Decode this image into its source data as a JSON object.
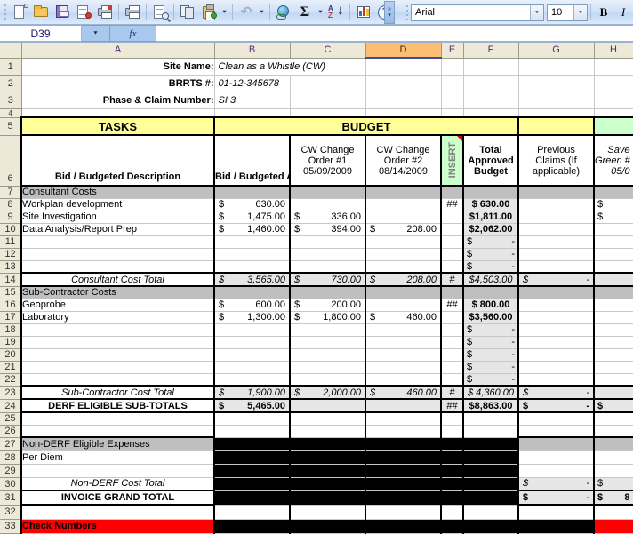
{
  "toolbar": {
    "icons": [
      "new-document",
      "open-folder",
      "save-floppy",
      "permission",
      "print-preview",
      "print",
      "spell-check",
      "copy",
      "paste",
      "undo",
      "hyperlink",
      "autosum",
      "sort-ascending",
      "chart-wizard",
      "help"
    ],
    "font_name": "Arial",
    "font_size": "10",
    "bold_label": "B",
    "italic_label": "I"
  },
  "formula_bar": {
    "name_box": "D39",
    "fx_label": "fx",
    "formula": ""
  },
  "columns": [
    "A",
    "B",
    "C",
    "D",
    "E",
    "F",
    "G",
    "H"
  ],
  "selected_column": "D",
  "row_numbers": [
    "1",
    "2",
    "3",
    "4",
    "5",
    "6",
    "7",
    "8",
    "9",
    "10",
    "11",
    "12",
    "13",
    "14",
    "15",
    "16",
    "17",
    "18",
    "19",
    "20",
    "21",
    "22",
    "23",
    "24",
    "25",
    "26",
    "27",
    "28",
    "29",
    "30",
    "31",
    "32",
    "33"
  ],
  "sheet": {
    "site_name_label": "Site Name:",
    "site_name_value": "Clean as a Whistle (CW)",
    "brrts_label": "BRRTS #:",
    "brrts_value": "01-12-345678",
    "phase_label": "Phase & Claim Number:",
    "phase_value": "SI 3",
    "tasks_header": "TASKS",
    "budget_header": "BUDGET",
    "col_headers": {
      "description": "Bid / Budgeted Description",
      "bid_amount": "Bid / Budgeted Amount",
      "cw1": "CW Change Order #1 05/09/2009",
      "cw1_l1": "CW Change",
      "cw1_l2": "Order #1",
      "cw1_l3": "05/09/2009",
      "cw2_l1": "CW Change",
      "cw2_l2": "Order #2",
      "cw2_l3": "08/14/2009",
      "insert": "INSERT",
      "total_l1": "Total",
      "total_l2": "Approved",
      "total_l3": "Budget",
      "prev_l1": "Previous",
      "prev_l2": "Claims (If",
      "prev_l3": "applicable)",
      "save_l1": "Save",
      "save_l2": "Green #",
      "save_l3": "05/0"
    },
    "sections": {
      "consultant": "Consultant Costs",
      "subcontractor": "Sub-Contractor Costs",
      "nonderf": "Non-DERF Eligible Expenses"
    },
    "rows": {
      "r8": {
        "desc": "Workplan development",
        "bid_sym": "$",
        "bid": "630.00",
        "cw1_sym": "",
        "cw1": "",
        "cw2_sym": "",
        "cw2": "",
        "ins": "##",
        "total": "$  630.00",
        "prev_sym": "",
        "prev": "",
        "save_sym": "$"
      },
      "r9": {
        "desc": "Site Investigation",
        "bid_sym": "$",
        "bid": "1,475.00",
        "cw1_sym": "$",
        "cw1": "336.00",
        "cw2_sym": "",
        "cw2": "",
        "ins": "",
        "total": "$1,811.00",
        "prev_sym": "",
        "prev": "",
        "save_sym": "$"
      },
      "r10": {
        "desc": "Data Analysis/Report Prep",
        "bid_sym": "$",
        "bid": "1,460.00",
        "cw1_sym": "$",
        "cw1": "394.00",
        "cw2_sym": "$",
        "cw2": "208.00",
        "ins": "",
        "total": "$2,062.00",
        "prev_sym": "",
        "prev": "",
        "save_sym": ""
      },
      "r11": {
        "desc": "",
        "bid_sym": "",
        "bid": "",
        "cw1_sym": "",
        "cw1": "",
        "cw2_sym": "",
        "cw2": "",
        "ins": "",
        "total_sym": "$",
        "total_val": "-",
        "prev_sym": "",
        "prev": "",
        "save_sym": ""
      },
      "r12": {
        "desc": "",
        "bid_sym": "",
        "bid": "",
        "cw1_sym": "",
        "cw1": "",
        "cw2_sym": "",
        "cw2": "",
        "ins": "",
        "total_sym": "$",
        "total_val": "-",
        "prev_sym": "",
        "prev": "",
        "save_sym": ""
      },
      "r13": {
        "desc": "",
        "bid_sym": "",
        "bid": "",
        "cw1_sym": "",
        "cw1": "",
        "cw2_sym": "",
        "cw2": "",
        "ins": "",
        "total_sym": "$",
        "total_val": "-",
        "prev_sym": "",
        "prev": "",
        "save_sym": ""
      },
      "r14": {
        "desc": "Consultant Cost Total",
        "bid_sym": "$",
        "bid": "3,565.00",
        "cw1_sym": "$",
        "cw1": "730.00",
        "cw2_sym": "$",
        "cw2": "208.00",
        "ins": "#",
        "total": "$4,503.00",
        "prev_sym": "$",
        "prev": "-",
        "save_sym": ""
      },
      "r16": {
        "desc": "Geoprobe",
        "bid_sym": "$",
        "bid": "600.00",
        "cw1_sym": "$",
        "cw1": "200.00",
        "cw2_sym": "",
        "cw2": "",
        "ins": "##",
        "total": "$  800.00",
        "prev_sym": "",
        "prev": "",
        "save_sym": ""
      },
      "r17": {
        "desc": "Laboratory",
        "bid_sym": "$",
        "bid": "1,300.00",
        "cw1_sym": "$",
        "cw1": "1,800.00",
        "cw2_sym": "$",
        "cw2": "460.00",
        "ins": "",
        "total": "$3,560.00",
        "prev_sym": "",
        "prev": "",
        "save_sym": ""
      },
      "r18": {
        "desc": "",
        "bid_sym": "",
        "bid": "",
        "cw1_sym": "",
        "cw1": "",
        "cw2_sym": "",
        "cw2": "",
        "ins": "",
        "total_sym": "$",
        "total_val": "-",
        "prev_sym": "",
        "prev": "",
        "save_sym": ""
      },
      "r19": {
        "desc": "",
        "bid_sym": "",
        "bid": "",
        "cw1_sym": "",
        "cw1": "",
        "cw2_sym": "",
        "cw2": "",
        "ins": "",
        "total_sym": "$",
        "total_val": "-",
        "prev_sym": "",
        "prev": "",
        "save_sym": ""
      },
      "r20": {
        "desc": "",
        "bid_sym": "",
        "bid": "",
        "cw1_sym": "",
        "cw1": "",
        "cw2_sym": "",
        "cw2": "",
        "ins": "",
        "total_sym": "$",
        "total_val": "-",
        "prev_sym": "",
        "prev": "",
        "save_sym": ""
      },
      "r21": {
        "desc": "",
        "bid_sym": "",
        "bid": "",
        "cw1_sym": "",
        "cw1": "",
        "cw2_sym": "",
        "cw2": "",
        "ins": "",
        "total_sym": "$",
        "total_val": "-",
        "prev_sym": "",
        "prev": "",
        "save_sym": ""
      },
      "r22": {
        "desc": "",
        "bid_sym": "",
        "bid": "",
        "cw1_sym": "",
        "cw1": "",
        "cw2_sym": "",
        "cw2": "",
        "ins": "",
        "total_sym": "$",
        "total_val": "-",
        "prev_sym": "",
        "prev": "",
        "save_sym": ""
      },
      "r23": {
        "desc": "Sub-Contractor Cost Total",
        "bid_sym": "$",
        "bid": "1,900.00",
        "cw1_sym": "$",
        "cw1": "2,000.00",
        "cw2_sym": "$",
        "cw2": "460.00",
        "ins": "#",
        "total": "$ 4,360.00",
        "prev_sym": "$",
        "prev": "-",
        "save_sym": ""
      },
      "r24": {
        "desc": "DERF ELIGIBLE SUB-TOTALS",
        "bid_sym": "$",
        "bid": "5,465.00",
        "cw1_sym": "",
        "cw1": "",
        "cw2_sym": "",
        "cw2": "",
        "ins": "##",
        "total": "$8,863.00",
        "prev_sym": "$",
        "prev": "-",
        "save_sym": "$"
      },
      "r28": {
        "desc": "Per Diem"
      },
      "r30": {
        "desc": "Non-DERF Cost Total",
        "prev_sym": "$",
        "prev": "-",
        "save_sym": "$"
      },
      "r31": {
        "desc": "INVOICE GRAND TOTAL",
        "prev_sym": "$",
        "prev": "-",
        "save_sym": "$",
        "save_val": "8"
      },
      "r33": {
        "desc": "Check Numbers"
      }
    }
  }
}
